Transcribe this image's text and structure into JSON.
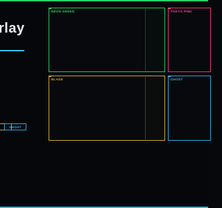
{
  "header": {
    "title": "rlay"
  },
  "theme_buttons": {
    "blade_label": "",
    "ghost_label": "GHOST"
  },
  "panels": {
    "neon_green": "NEON GREEN",
    "tokyo_pink": "TOKYO PINK",
    "blade": "BLADE",
    "ghost": "GHOST"
  },
  "colors": {
    "green": "#22d36a",
    "pink": "#f04a8e",
    "yellow": "#d4ad2c",
    "blue": "#3ab6e4",
    "background": "#06070b"
  }
}
